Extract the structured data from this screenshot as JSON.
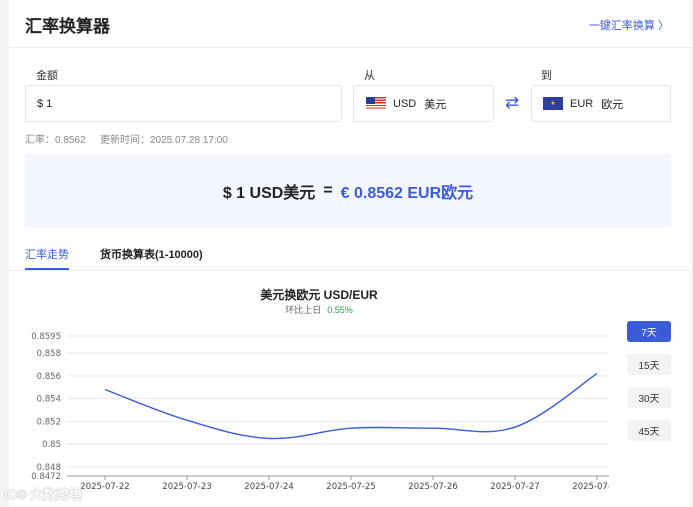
{
  "header": {
    "title": "汇率换算器",
    "quick_link": "一键汇率换算 〉"
  },
  "amount": {
    "label": "金额",
    "value": "$ 1"
  },
  "from": {
    "label": "从",
    "code": "USD",
    "name": "美元"
  },
  "to": {
    "label": "到",
    "code": "EUR",
    "name": "欧元"
  },
  "swap_icon": "⇄",
  "rate_info": {
    "rate": "汇率：0.8562",
    "updated": "更新时间：2025.07.28 17:00"
  },
  "result": {
    "left": "$ 1 USD美元",
    "eq": "=",
    "right": "€ 0.8562 EUR欧元"
  },
  "tabs": [
    {
      "label": "汇率走势",
      "active": true
    },
    {
      "label": "货币换算表(1-10000)",
      "active": false
    }
  ],
  "range_buttons": [
    {
      "label": "7天",
      "active": true
    },
    {
      "label": "15天"
    },
    {
      "label": "30天"
    },
    {
      "label": "45天"
    }
  ],
  "watermark": "IC® 大数跨境",
  "chart_data": {
    "type": "line",
    "title": "美元换欧元  USD/EUR",
    "subtitle_label": "环比上日",
    "subtitle_value": "0.55%",
    "x": [
      "2025-07-22",
      "2025-07-23",
      "2025-07-24",
      "2025-07-25",
      "2025-07-26",
      "2025-07-27",
      "2025-07-28"
    ],
    "series": [
      {
        "values": [
          0.8548,
          0.8521,
          0.8505,
          0.8514,
          0.8514,
          0.8515,
          0.8562
        ]
      }
    ],
    "yticks": [
      0.8472,
      0.848,
      0.85,
      0.852,
      0.854,
      0.856,
      0.858,
      0.8595
    ],
    "ylim": [
      0.8472,
      0.8595
    ],
    "grid": true,
    "line_color": "#3b5bdb"
  }
}
